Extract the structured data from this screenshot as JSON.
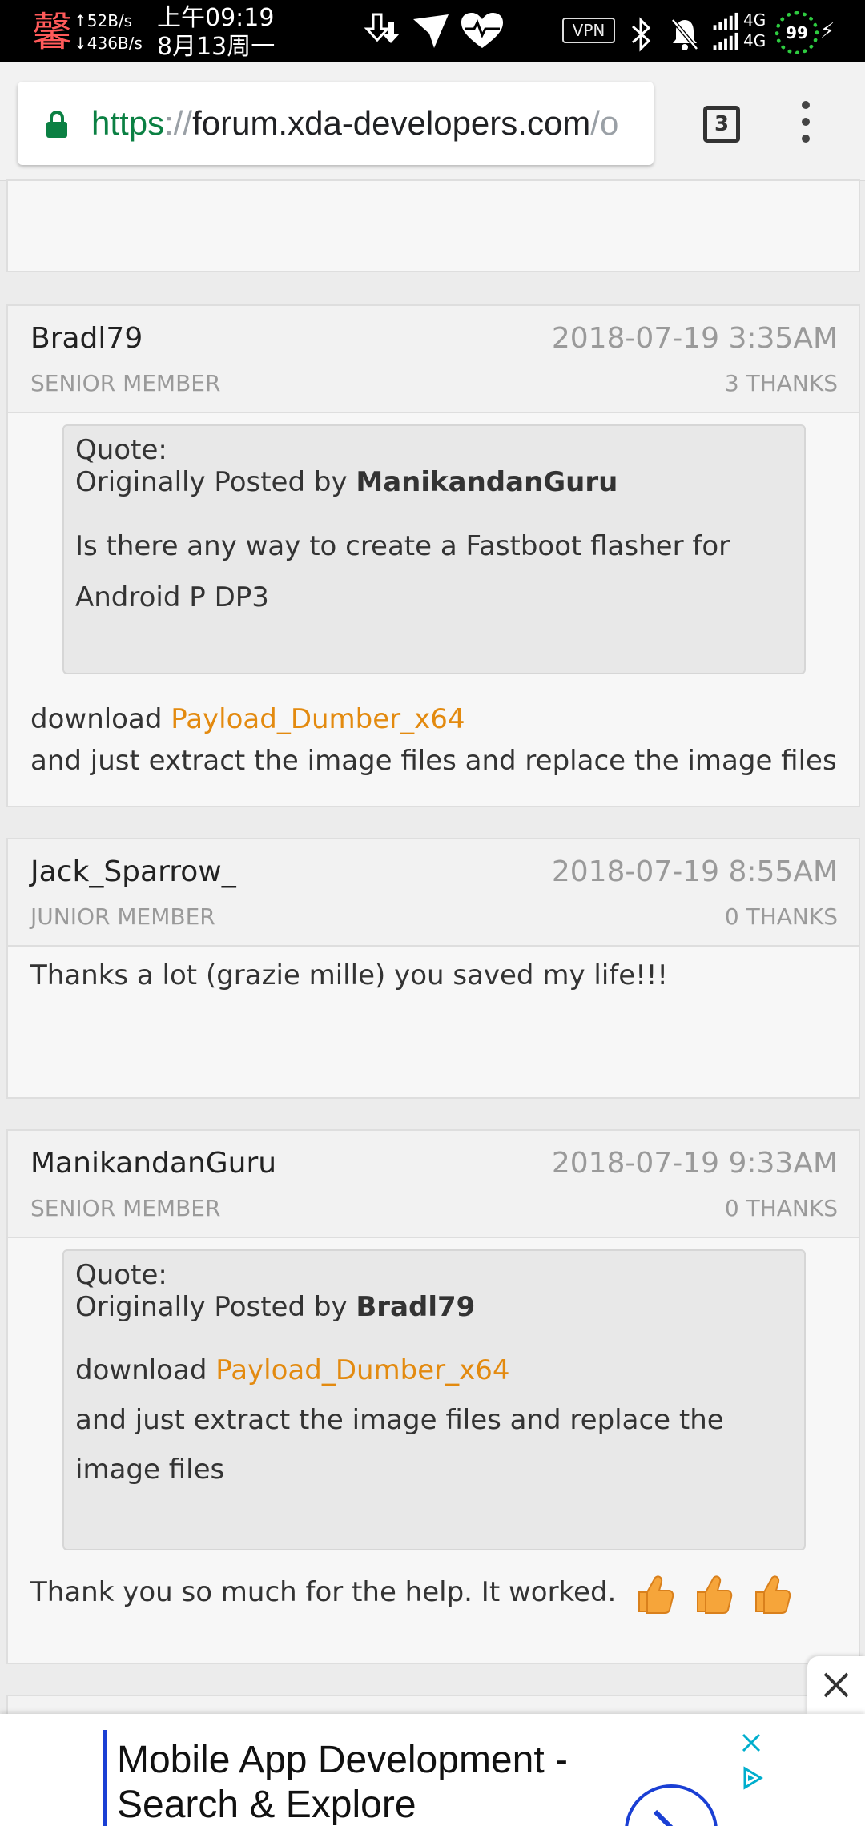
{
  "status_bar": {
    "app_glyph": "馨",
    "upload_speed": "↑52B/s",
    "download_speed": "↓436B/s",
    "time": "上午09:19",
    "date": "8月13周一",
    "vpn_label": "VPN",
    "network_1": "4G",
    "network_2": "4G",
    "battery": "99"
  },
  "browser": {
    "url_scheme": "https",
    "url_sep": "://",
    "url_host": "forum.xda-developers.com",
    "url_path": "/o",
    "tab_count": "3"
  },
  "posts": [
    {
      "username": "Bradl79",
      "rank": "SENIOR MEMBER",
      "date": "2018-07-19 3:35AM",
      "thanks": "3 THANKS",
      "quote": {
        "label": "Quote:",
        "by_prefix": "Originally Posted by ",
        "by_user": "ManikandanGuru",
        "text": "Is there any way to create a Fastboot flasher for Android P DP3"
      },
      "body_prefix": "download ",
      "body_link": "Payload_Dumber_x64",
      "body_rest": "and just extract the image files and replace the image files"
    },
    {
      "username": "Jack_Sparrow_",
      "rank": "JUNIOR MEMBER",
      "date": "2018-07-19 8:55AM",
      "thanks": "0 THANKS",
      "body": "Thanks a lot (grazie mille) you saved my life!!!"
    },
    {
      "username": "ManikandanGuru",
      "rank": "SENIOR MEMBER",
      "date": "2018-07-19 9:33AM",
      "thanks": "0 THANKS",
      "quote": {
        "label": "Quote:",
        "by_prefix": "Originally Posted by ",
        "by_user": "Bradl79",
        "text_prefix": "download ",
        "text_link": "Payload_Dumber_x64",
        "text_rest": "and just extract the image files and replace the image files"
      },
      "body": "Thank you so much for the help. It worked."
    }
  ],
  "ad": {
    "title": "Mobile App Development - Search & Explore"
  },
  "colors": {
    "link": "#e38a0f",
    "url_secure": "#0b8043",
    "ad_accent": "#1a3fd4"
  },
  "icons": [
    "lock-icon",
    "tab-switcher-icon",
    "overflow-menu-icon",
    "thumbs-up-icon",
    "close-icon",
    "adchoices-icon"
  ]
}
